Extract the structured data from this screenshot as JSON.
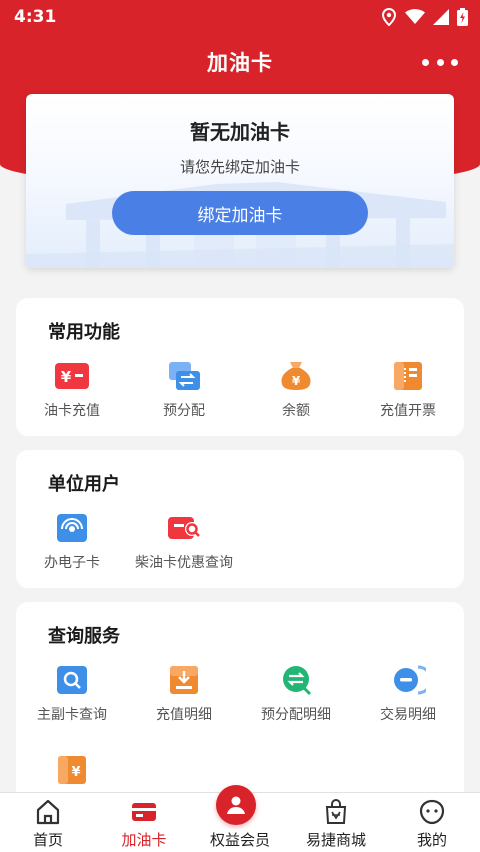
{
  "status_bar": {
    "time": "4:31"
  },
  "header": {
    "title": "加油卡"
  },
  "banner": {
    "title": "暂无加油卡",
    "subtitle": "请您先绑定加油卡",
    "button_label": "绑定加油卡"
  },
  "common": {
    "title": "常用功能",
    "items": [
      {
        "label": "油卡充值",
        "icon": "yuan-card-icon"
      },
      {
        "label": "预分配",
        "icon": "transfer-icon"
      },
      {
        "label": "余额",
        "icon": "money-bag-icon"
      },
      {
        "label": "充值开票",
        "icon": "invoice-icon"
      }
    ]
  },
  "corporate": {
    "title": "单位用户",
    "items": [
      {
        "label": "办电子卡",
        "icon": "electronic-card-icon"
      },
      {
        "label": "柴油卡优惠查询",
        "icon": "diesel-card-search-icon"
      }
    ]
  },
  "query": {
    "title": "查询服务",
    "items": [
      {
        "label": "主副卡查询",
        "icon": "card-search-icon"
      },
      {
        "label": "充值明细",
        "icon": "recharge-detail-icon"
      },
      {
        "label": "预分配明细",
        "icon": "allocation-detail-icon"
      },
      {
        "label": "交易明细",
        "icon": "transaction-detail-icon"
      }
    ]
  },
  "tabbar": {
    "items": [
      {
        "label": "首页",
        "icon": "home-icon",
        "active": false
      },
      {
        "label": "加油卡",
        "icon": "fuel-card-icon",
        "active": true
      },
      {
        "label": "权益会员",
        "icon": "member-icon",
        "active": false
      },
      {
        "label": "易捷商城",
        "icon": "mall-bag-icon",
        "active": false
      },
      {
        "label": "我的",
        "icon": "profile-face-icon",
        "active": false
      }
    ]
  },
  "colors": {
    "brand_red": "#d8232a",
    "button_blue": "#4a7fe5",
    "icon_red": "#f0363f",
    "icon_blue": "#3d8fe8",
    "icon_orange": "#f08a30",
    "icon_green": "#22b573"
  }
}
